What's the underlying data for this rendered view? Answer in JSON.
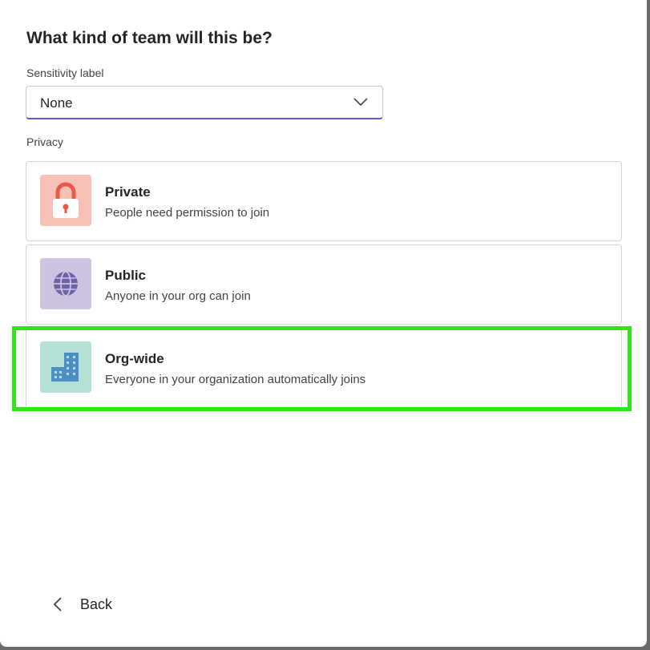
{
  "dialog": {
    "title": "What kind of team will this be?"
  },
  "sensitivity": {
    "label": "Sensitivity label",
    "value": "None"
  },
  "privacy": {
    "label": "Privacy",
    "options": [
      {
        "title": "Private",
        "description": "People need permission to join",
        "icon": "lock-icon",
        "icon_bg": "#f8c1b6",
        "icon_color": "#e8594a"
      },
      {
        "title": "Public",
        "description": "Anyone in your org can join",
        "icon": "globe-icon",
        "icon_bg": "#ccc4e0",
        "icon_color": "#6e62a9"
      },
      {
        "title": "Org-wide",
        "description": "Everyone in your organization automatically joins",
        "icon": "building-icon",
        "icon_bg": "#b4e0d6",
        "icon_color": "#4d8ec6"
      }
    ]
  },
  "footer": {
    "back_label": "Back"
  },
  "colors": {
    "accent": "#5b5fc7",
    "highlight": "#2ee516"
  }
}
